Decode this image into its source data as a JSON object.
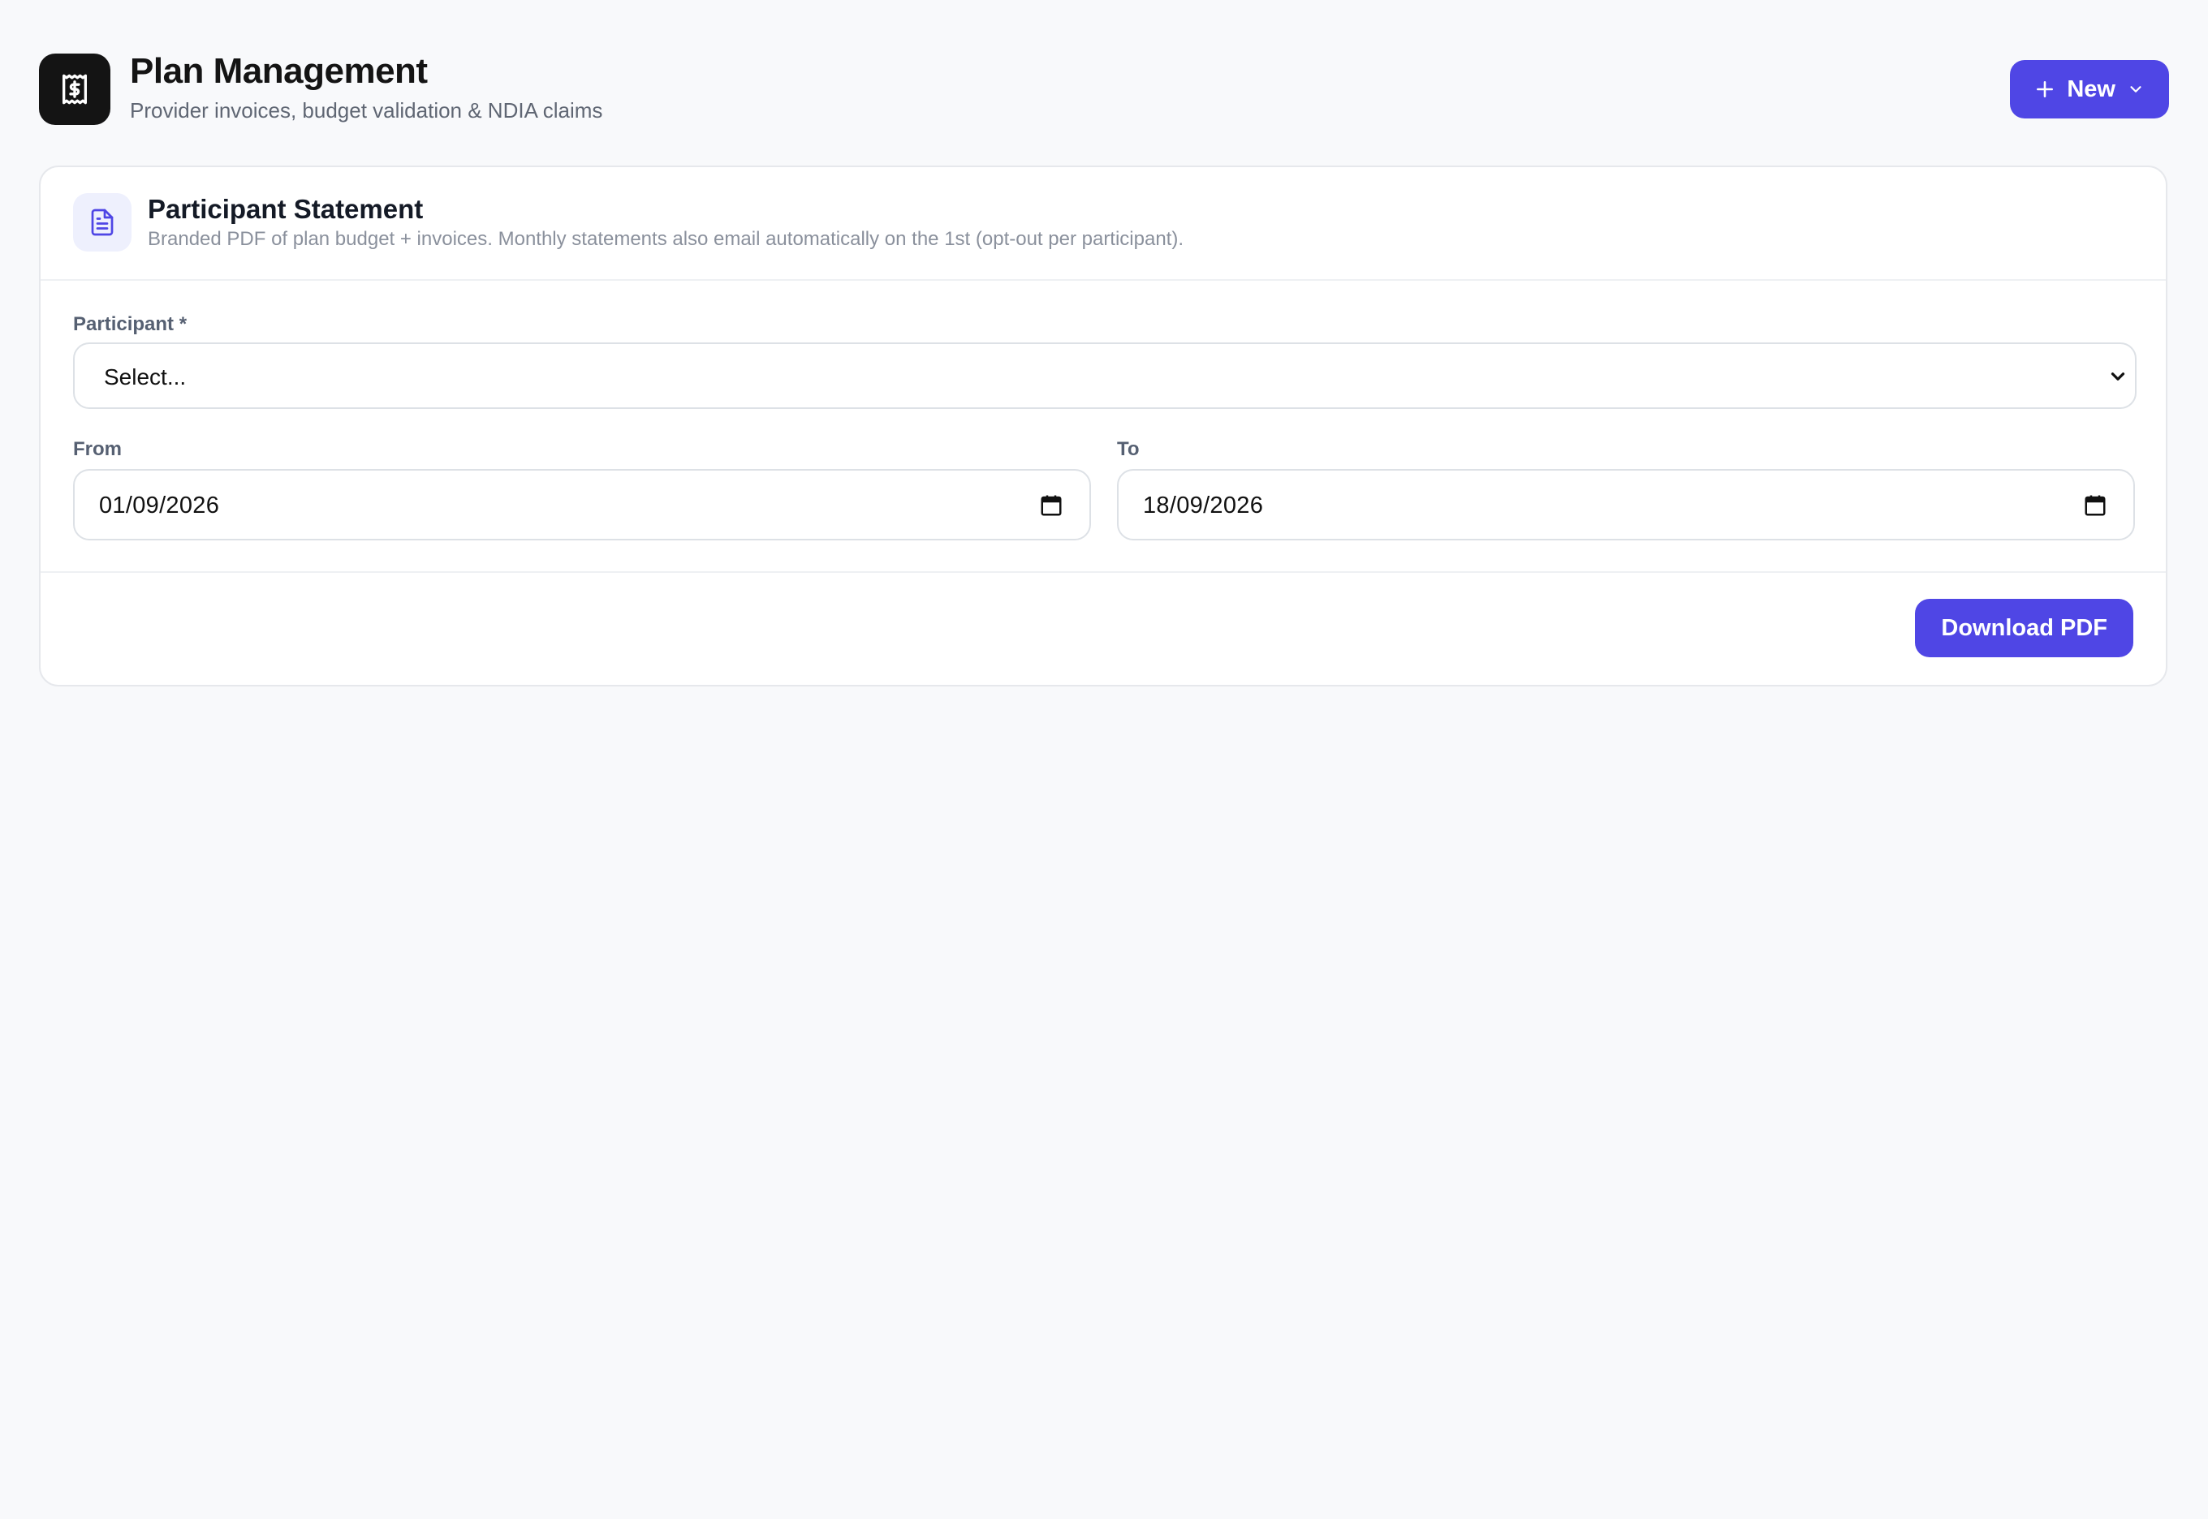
{
  "header": {
    "title": "Plan Management",
    "subtitle": "Provider invoices, budget validation & NDIA claims",
    "new_label": "New",
    "logo_icon": "dollar-receipt-icon"
  },
  "statement_card": {
    "icon": "document-icon",
    "title": "Participant Statement",
    "description": "Branded PDF of plan budget + invoices. Monthly statements also email automatically on the 1st (opt-out per participant).",
    "participant_label": "Participant *",
    "participant_value": "Select...",
    "from_label": "From",
    "from_value": "01/09/2026",
    "to_label": "To",
    "to_value": "18/09/2026",
    "download_label": "Download PDF"
  },
  "colors": {
    "accent": "#4f46e5",
    "logo_bg": "#141414",
    "background": "#f8f9fb"
  }
}
